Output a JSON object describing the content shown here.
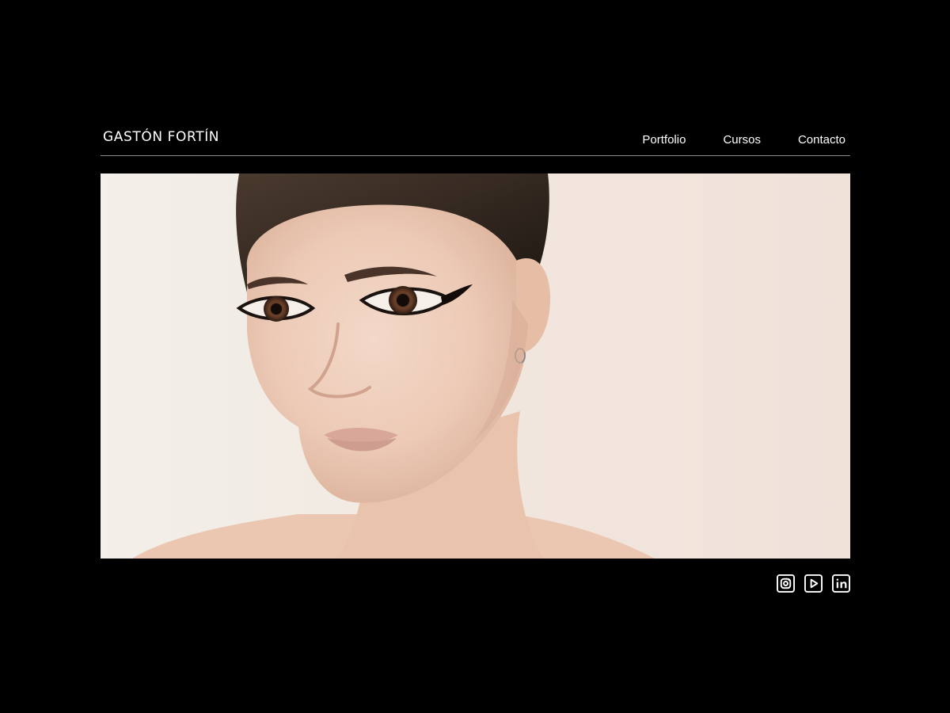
{
  "brand": {
    "name": "GASTÓN FORTÍN"
  },
  "nav": {
    "items": [
      {
        "label": "Portfolio"
      },
      {
        "label": "Cursos"
      },
      {
        "label": "Contacto"
      }
    ]
  },
  "hero": {
    "image": "portrait-photo",
    "background_color": "#f1e6de"
  },
  "social": {
    "icons": [
      "instagram-icon",
      "youtube-icon",
      "linkedin-icon"
    ]
  },
  "colors": {
    "background": "#000000",
    "text": "#ffffff",
    "divider": "#8a8a8a"
  }
}
